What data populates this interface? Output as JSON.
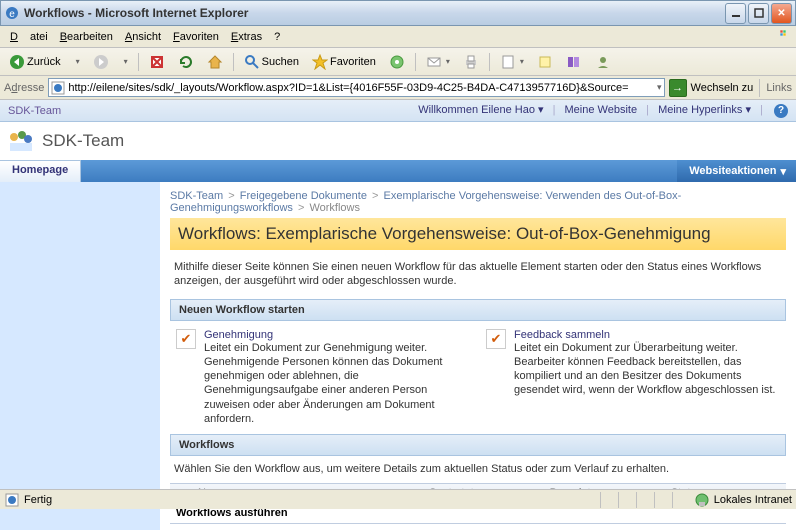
{
  "window": {
    "title": "Workflows - Microsoft Internet Explorer"
  },
  "menu": {
    "file": "Datei",
    "edit": "Bearbeiten",
    "view": "Ansicht",
    "favorites": "Favoriten",
    "extras": "Extras",
    "help": "?"
  },
  "toolbar": {
    "back": "Zurück",
    "search": "Suchen",
    "favorites": "Favoriten"
  },
  "address": {
    "label": "Adresse",
    "url": "http://eilene/sites/sdk/_layouts/Workflow.aspx?ID=1&List={4016F55F-03D9-4C25-B4DA-C4713957716D}&Source=",
    "go": "Wechseln zu",
    "links": "Links"
  },
  "sp": {
    "sitepath": "SDK-Team",
    "welcome": "Willkommen Eilene Hao",
    "mysite": "Meine Website",
    "mylinks": "Meine Hyperlinks",
    "title": "SDK-Team",
    "tab_home": "Homepage",
    "siteactions": "Websiteaktionen"
  },
  "breadcrumb": {
    "a": "SDK-Team",
    "b": "Freigegebene Dokumente",
    "c": "Exemplarische Vorgehensweise: Verwenden des Out-of-Box-Genehmigungsworkflows",
    "d": "Workflows"
  },
  "page": {
    "title": "Workflows: Exemplarische Vorgehensweise: Out-of-Box-Genehmigung",
    "desc": "Mithilfe dieser Seite können Sie einen neuen Workflow für das aktuelle Element starten oder den Status eines Workflows anzeigen, der ausgeführt wird oder abgeschlossen wurde."
  },
  "sections": {
    "start_new": "Neuen Workflow starten",
    "workflows": "Workflows",
    "select_hint": "Wählen Sie den Workflow aus, um weitere Details zum aktuellen Status oder zum Verlauf zu erhalten.",
    "running": "Workflows ausführen"
  },
  "opts": {
    "approve_title": "Genehmigung",
    "approve_desc": "Leitet ein Dokument zur Genehmigung weiter. Genehmigende Personen können das Dokument genehmigen oder ablehnen, die Genehmigungsaufgabe einer anderen Person zuweisen oder aber Änderungen am Dokument anfordern.",
    "feedback_title": "Feedback sammeln",
    "feedback_desc": "Leitet ein Dokument zur Überarbeitung weiter. Bearbeiter können Feedback bereitstellen, das kompiliert und an den Besitzer des Dokuments gesendet wird, wenn der Workflow abgeschlossen ist."
  },
  "cols": {
    "name": "Name",
    "started": "Gestartet",
    "ended": "Beendet",
    "status": "Status"
  },
  "status": {
    "done": "Fertig",
    "zone": "Lokales Intranet"
  }
}
